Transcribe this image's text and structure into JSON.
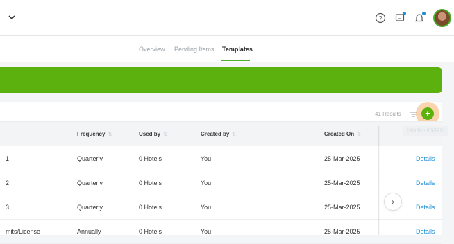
{
  "tabs": [
    {
      "label": "Overview",
      "active": false
    },
    {
      "label": "Pending Items",
      "active": false
    },
    {
      "label": "Templates",
      "active": true
    }
  ],
  "header_icons": [
    "chevron-down-icon",
    "help-icon",
    "feedback-icon",
    "notification-icon",
    "avatar"
  ],
  "colors": {
    "accent": "#5cb10f",
    "link": "#1c8fd6",
    "highlight": "#f5a046"
  },
  "results_label": "41 Results",
  "add_button_symbol": "+",
  "tooltip": "Create Template",
  "table": {
    "columns": {
      "frequency": "Frequency",
      "used_by": "Used by",
      "created_by": "Created by",
      "created_on": "Created On"
    },
    "rows": [
      {
        "name": "1",
        "frequency": "Quarterly",
        "used_by": "0 Hotels",
        "created_by": "You",
        "created_on": "25-Mar-2025",
        "action": "Details"
      },
      {
        "name": "2",
        "frequency": "Quarterly",
        "used_by": "0 Hotels",
        "created_by": "You",
        "created_on": "25-Mar-2025",
        "action": "Details"
      },
      {
        "name": "3",
        "frequency": "Quarterly",
        "used_by": "0 Hotels",
        "created_by": "You",
        "created_on": "25-Mar-2025",
        "action": "Details"
      },
      {
        "name": "mits/License",
        "frequency": "Annually",
        "used_by": "0 Hotels",
        "created_by": "You",
        "created_on": "25-Mar-2025",
        "action": "Details"
      }
    ]
  },
  "next_symbol": "›"
}
